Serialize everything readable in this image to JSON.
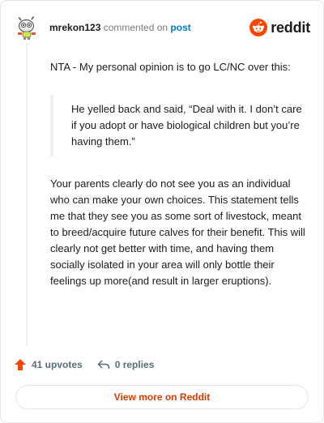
{
  "header": {
    "username": "mrekon123",
    "action_text": " commented on ",
    "post_label": "post",
    "brand": "reddit"
  },
  "comment": {
    "intro": "NTA - My personal opinion is to go LC/NC over this:",
    "quote": "He yelled back and said, “Deal with it. I don’t care if you adopt or have biological children but you’re having them.”",
    "body": "Your parents clearly do not see you as an individual who can make your own choices. This statement tells me that they see you as some sort of livestock, meant to breed/acquire future calves for their benefit. This will clearly not get better with time, and having them socially isolated in your area will only bottle their feelings up more(and result in larger eruptions)."
  },
  "footer": {
    "upvotes": "41 upvotes",
    "replies": "0 replies"
  },
  "view_more": "View more on Reddit",
  "colors": {
    "accent": "#ff4500",
    "link": "#0079d3",
    "view_more_text": "#d93a00"
  },
  "icons": {
    "avatar": "snoo-avatar",
    "brand": "reddit-logo-icon",
    "upvote": "upvote-arrow-icon",
    "reply": "reply-arrow-icon"
  }
}
